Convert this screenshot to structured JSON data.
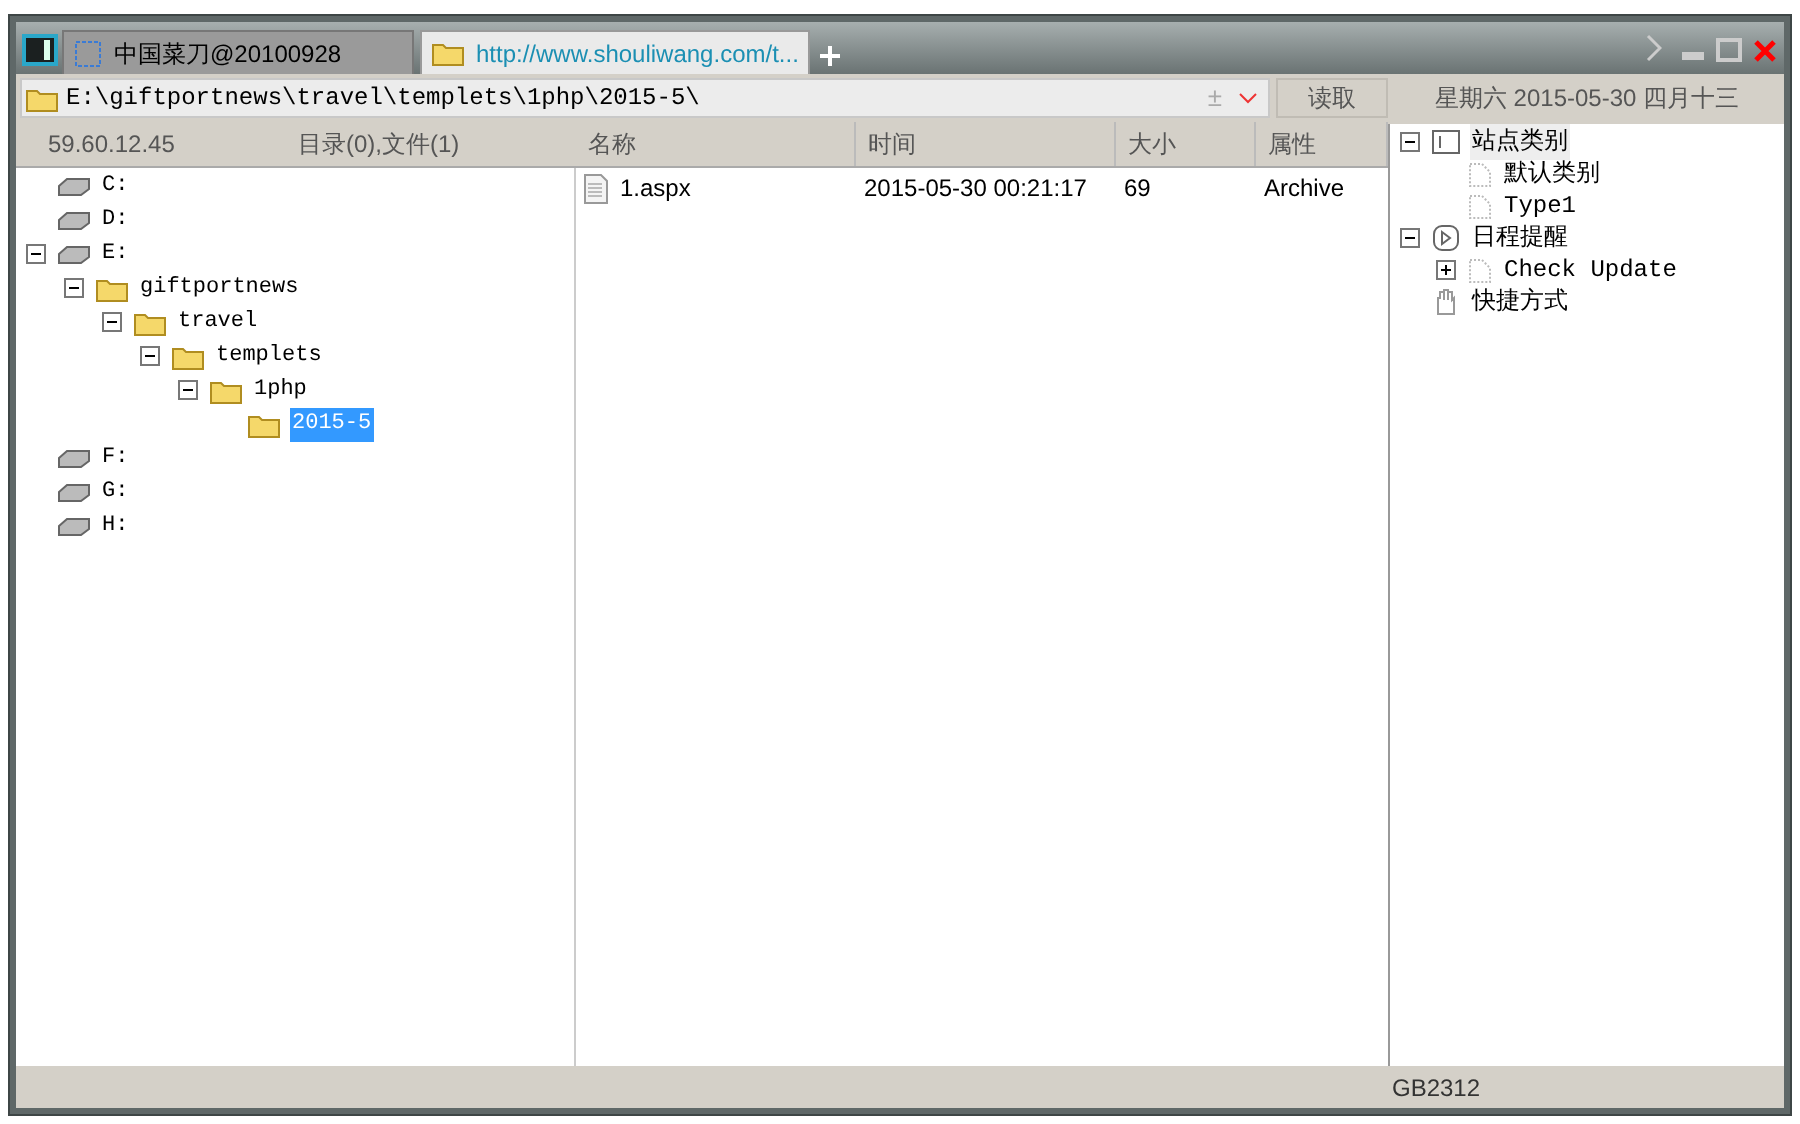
{
  "tabs": [
    {
      "label": "中国菜刀@20100928",
      "selected": false,
      "kind": "blank"
    },
    {
      "label": "http://www.shouliwang.com/t...",
      "selected": true,
      "kind": "folder"
    }
  ],
  "address": {
    "value": "E:\\giftportnews\\travel\\templets\\1php\\2015-5\\",
    "mark": "±",
    "button": "读取",
    "date": "星期六 2015-05-30 四月十三"
  },
  "left_header": {
    "ip": "59.60.12.45",
    "summary": "目录(0),文件(1)"
  },
  "tree": [
    {
      "label": "C:",
      "kind": "drive"
    },
    {
      "label": "D:",
      "kind": "drive"
    },
    {
      "label": "E:",
      "kind": "drive",
      "expanded": true,
      "children": [
        {
          "label": "giftportnews",
          "kind": "folder",
          "expanded": true,
          "children": [
            {
              "label": "travel",
              "kind": "folder",
              "expanded": true,
              "children": [
                {
                  "label": "templets",
                  "kind": "folder",
                  "expanded": true,
                  "children": [
                    {
                      "label": "1php",
                      "kind": "folder",
                      "expanded": true,
                      "children": [
                        {
                          "label": "2015-5",
                          "kind": "folder",
                          "selected": true
                        }
                      ]
                    }
                  ]
                }
              ]
            }
          ]
        }
      ]
    },
    {
      "label": "F:",
      "kind": "drive"
    },
    {
      "label": "G:",
      "kind": "drive"
    },
    {
      "label": "H:",
      "kind": "drive"
    }
  ],
  "table": {
    "columns": [
      "名称",
      "时间",
      "大小",
      "属性"
    ],
    "rows": [
      [
        "1.aspx",
        "2015-05-30 00:21:17",
        "69",
        "Archive"
      ]
    ]
  },
  "side_tree": [
    {
      "label": "站点类别",
      "kind": "square",
      "expanded": true,
      "selected": true,
      "children": [
        {
          "label": "默认类别",
          "kind": "page",
          "selected": false
        },
        {
          "label": "Type1",
          "kind": "page",
          "selected": false
        }
      ]
    },
    {
      "label": "日程提醒",
      "kind": "clock",
      "expanded": true,
      "selected": false,
      "children": [
        {
          "label": "Check Update",
          "kind": "page",
          "expanded": false,
          "selected": false
        }
      ]
    },
    {
      "label": "快捷方式",
      "kind": "hand",
      "selected": false
    }
  ],
  "status_bar": {
    "encoding": "GB2312"
  }
}
